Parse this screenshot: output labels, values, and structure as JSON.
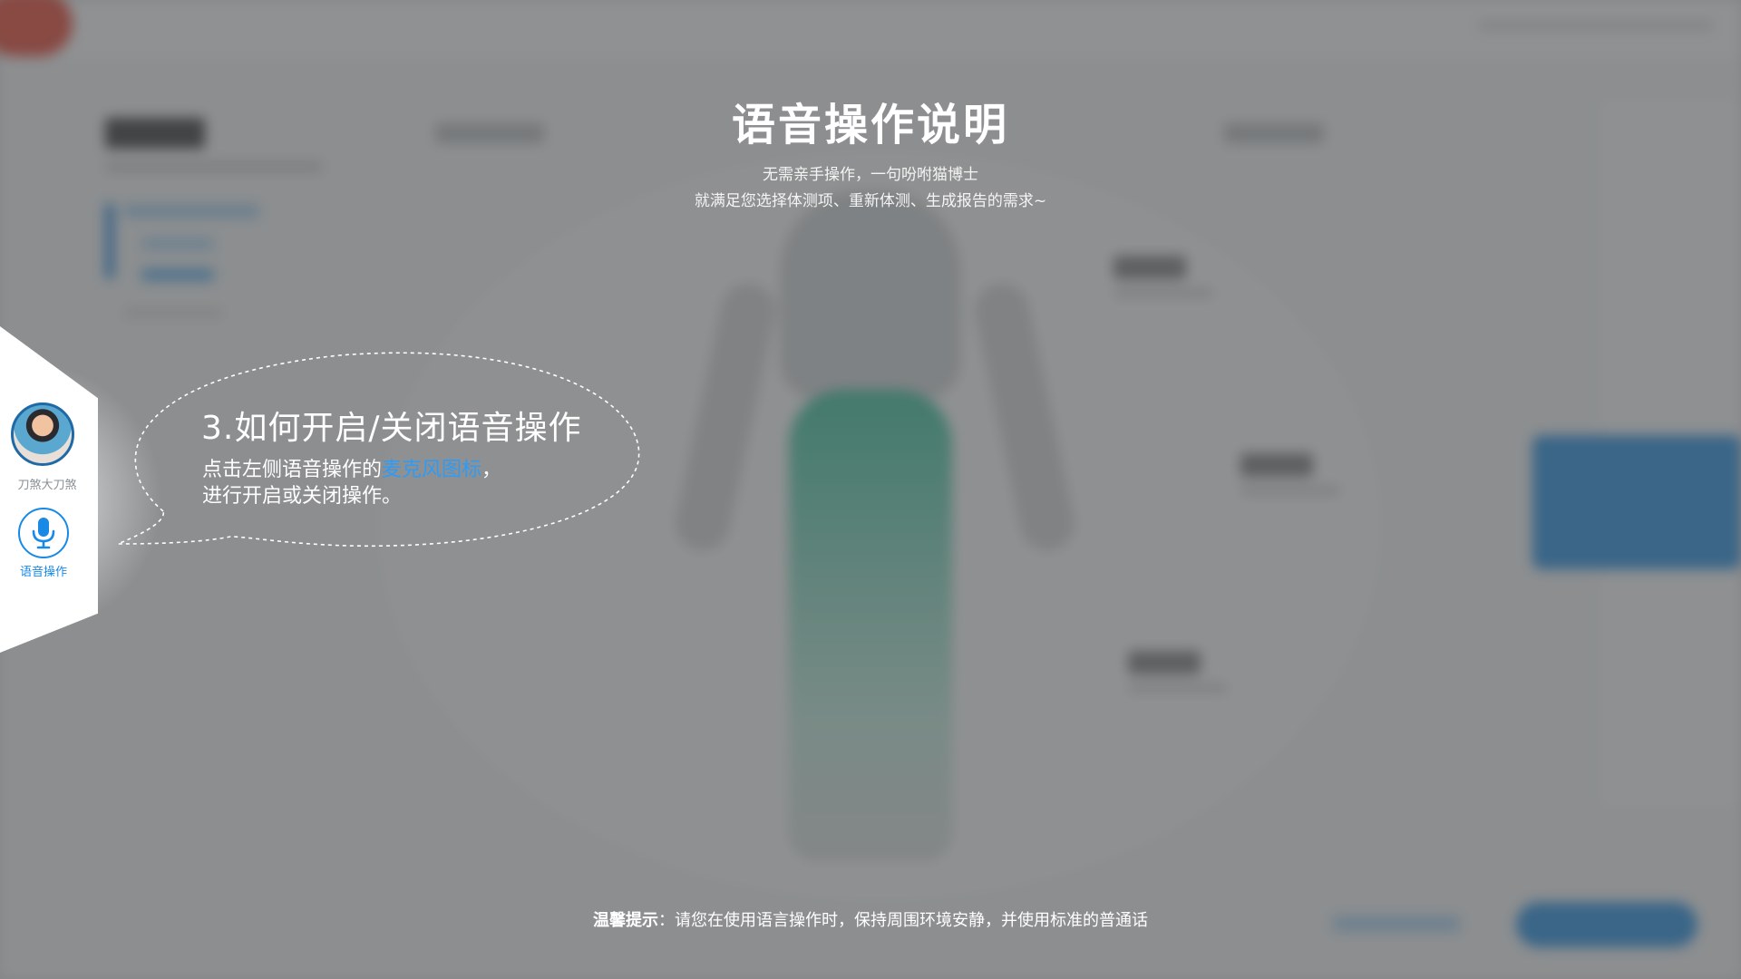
{
  "overlay": {
    "title": "语音操作说明",
    "subtitle_line1": "无需亲手操作，一句吩咐猫博士",
    "subtitle_line2": "就满足您选择体测项、重新体测、生成报告的需求~"
  },
  "callout": {
    "heading": "3.如何开启/关闭语音操作",
    "body_prefix": "点击左侧语音操作的",
    "body_highlight": "麦克风图标",
    "body_suffix": "，",
    "body_line2": "进行开启或关闭操作。"
  },
  "sidebar": {
    "user_name": "刀煞大刀煞",
    "voice_label": "语音操作"
  },
  "tip": {
    "label": "温馨提示",
    "colon": "：",
    "text": "请您在使用语言操作时，保持周围环境安静，并使用标准的普通话"
  },
  "colors": {
    "accent": "#1989e6",
    "highlight": "#2c9cf8",
    "overlay": "rgba(70,72,74,0.58)"
  },
  "icons": {
    "mic": "microphone-icon",
    "avatar": "user-avatar"
  }
}
